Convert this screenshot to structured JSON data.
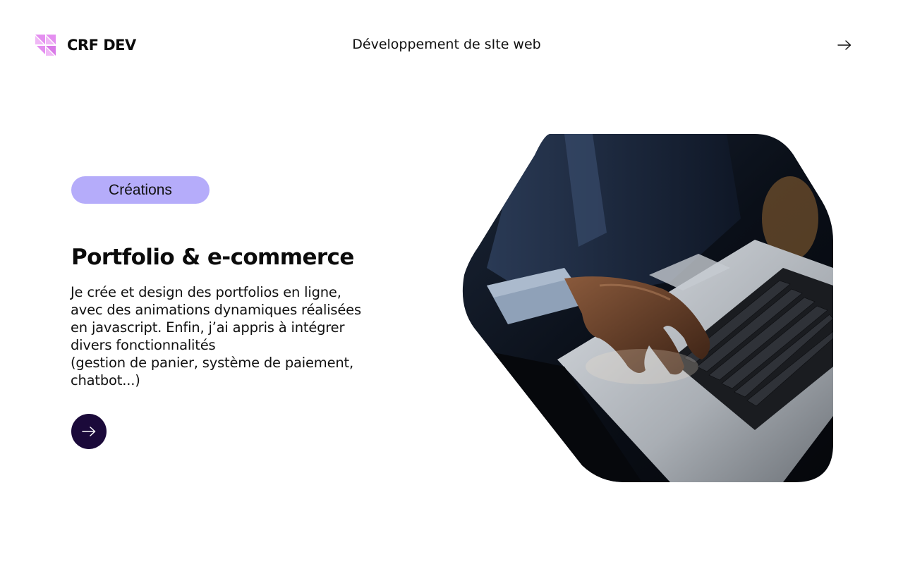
{
  "brand": {
    "name": "CRF DEV",
    "logo_icon": "triangles-logo-icon",
    "logo_color": "#e48ff0"
  },
  "header": {
    "tagline": "Développement de sIte web",
    "next_icon": "arrow-right-icon"
  },
  "main": {
    "tag_label": "Créations",
    "tag_color": "#b5acfa",
    "title": "Portfolio & e-commerce",
    "description_lines": [
      "Je crée et design des portfolios en ligne,",
      "avec des animations dynamiques réalisées",
      "en javascript. Enfin, j’ai appris à intégrer",
      "divers fonctionnalités",
      "(gestion de panier, système de paiement,",
      "chatbot...)"
    ],
    "cta_icon": "arrow-right-icon",
    "cta_color": "#1b0a3a"
  },
  "hero": {
    "image_subject": "hands typing on laptop keyboard",
    "shape": "hexagon"
  }
}
